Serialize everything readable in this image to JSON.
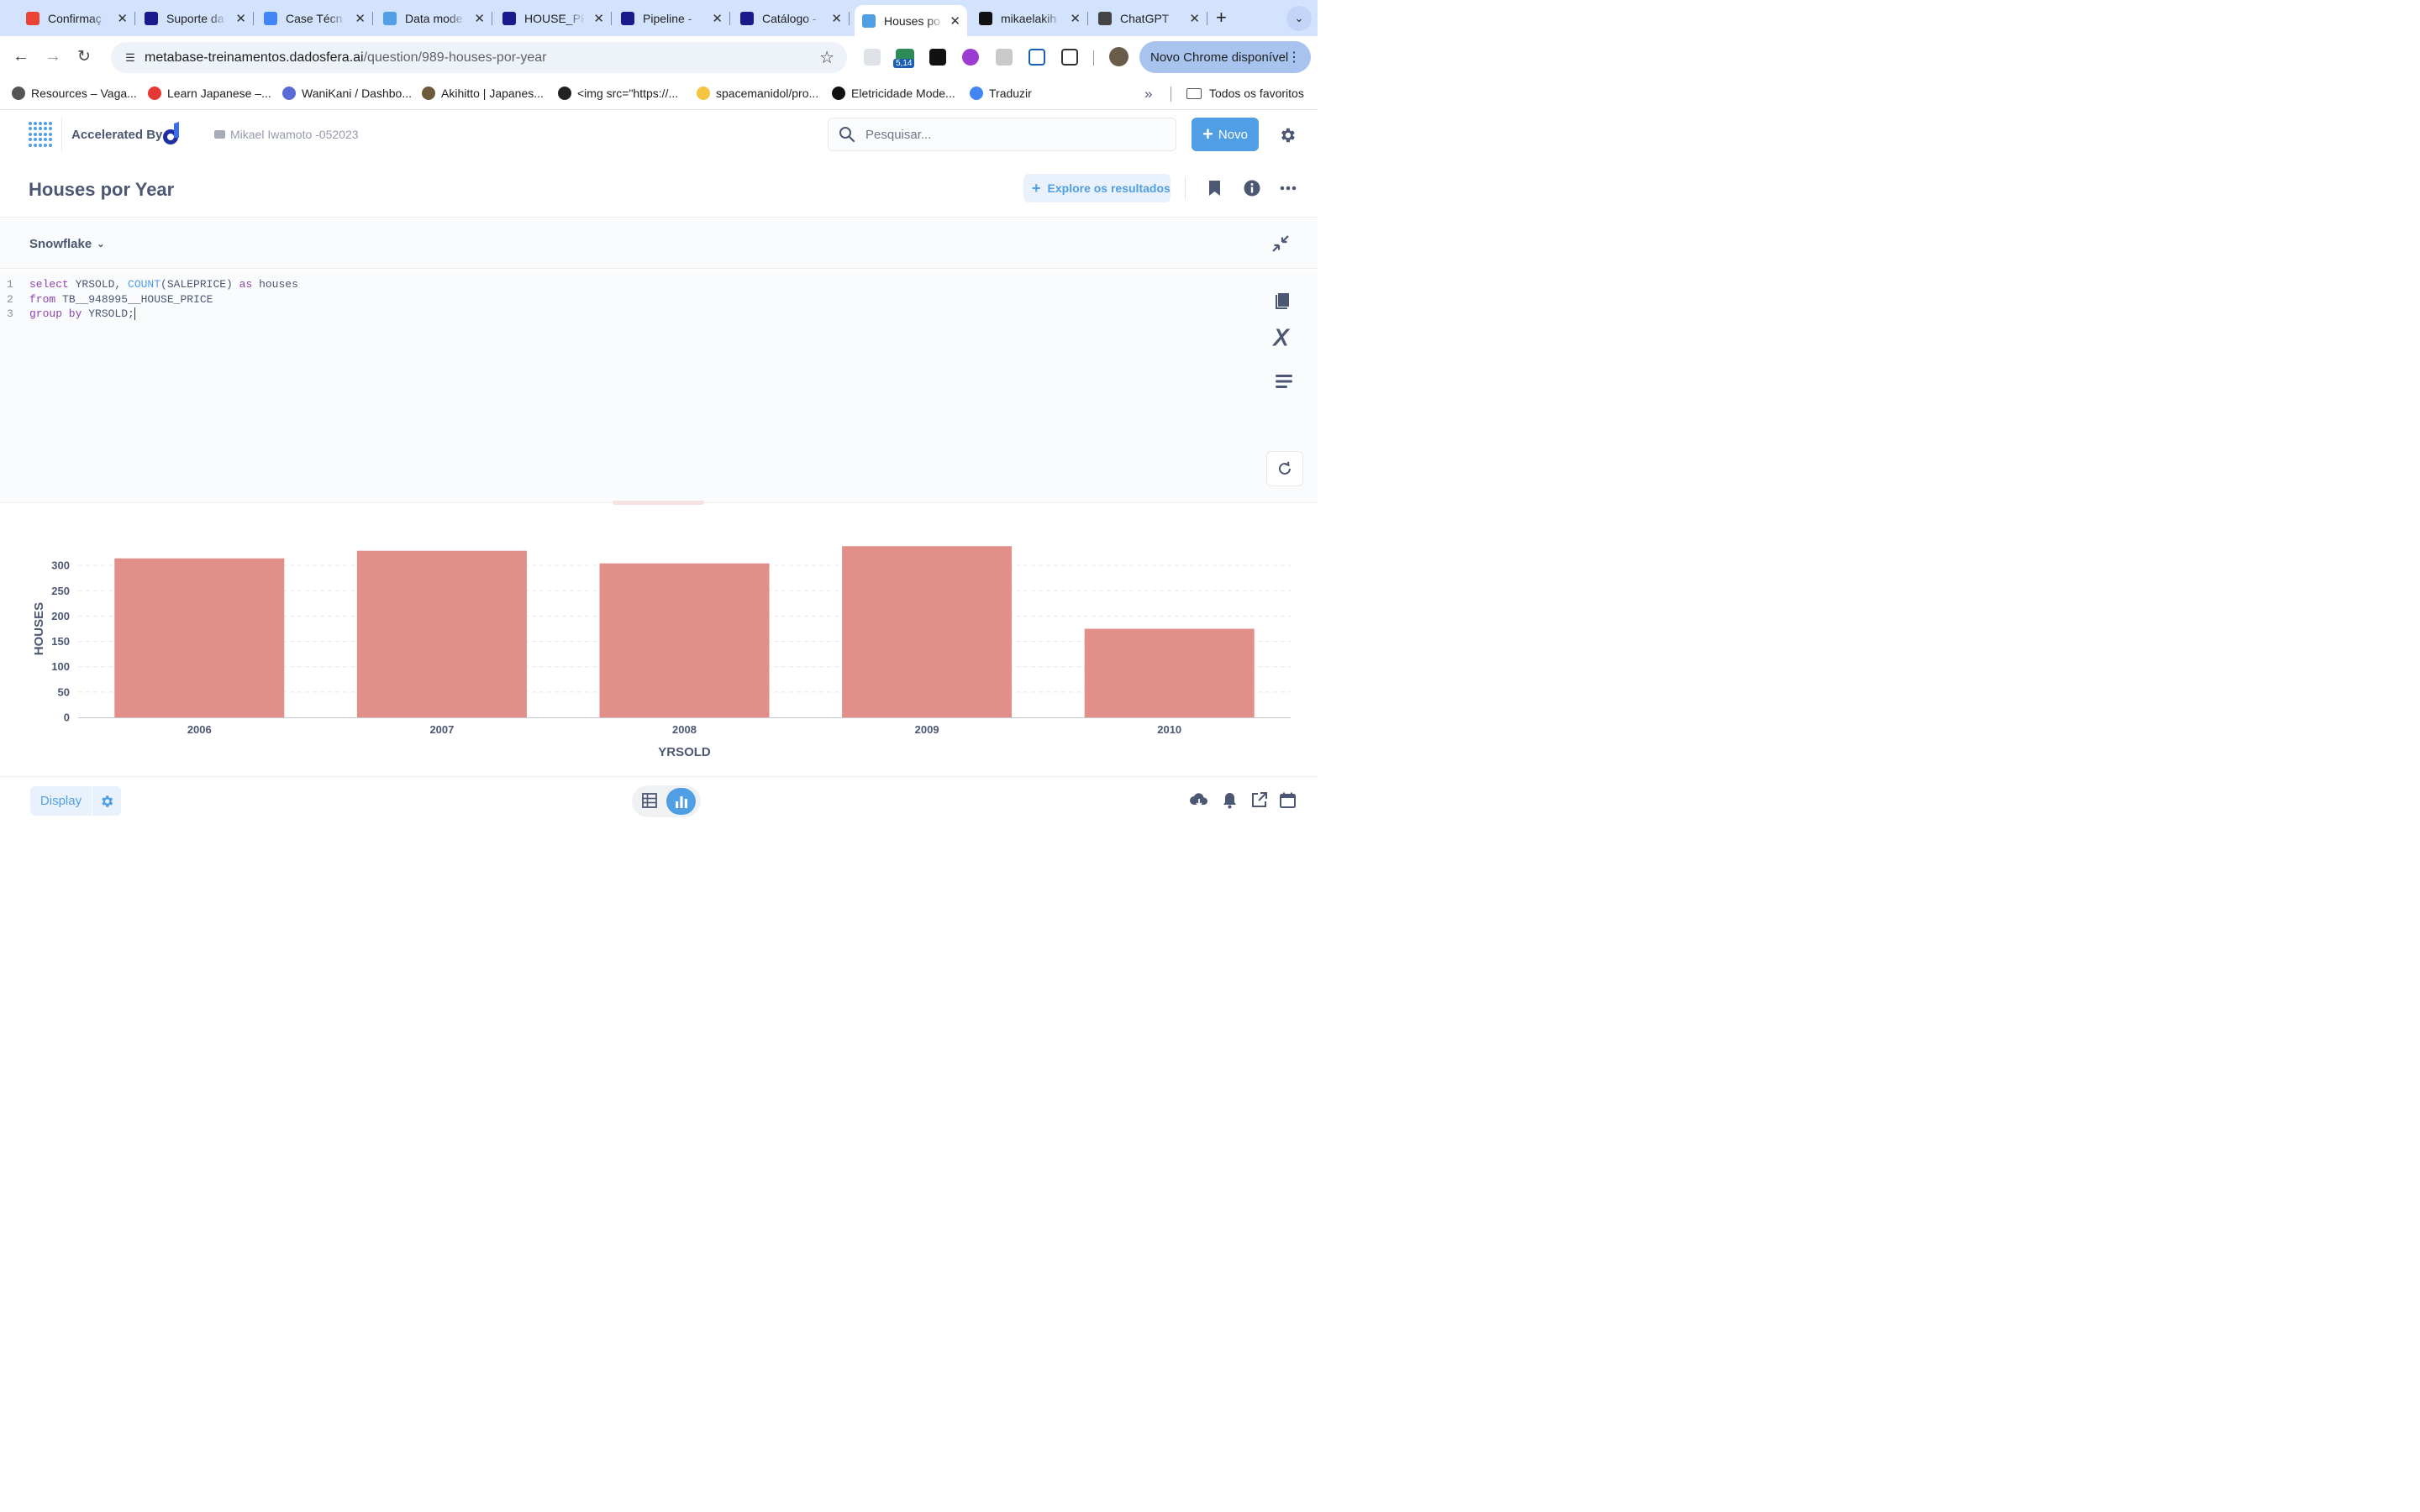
{
  "browser": {
    "tabs": [
      {
        "title": "Confirmaç",
        "favicon": "gmail-icon",
        "color": "#ea4335"
      },
      {
        "title": "Suporte da",
        "favicon": "dadosfera-icon",
        "color": "#1a1a8c"
      },
      {
        "title": "Case Técn",
        "favicon": "google-docs-icon",
        "color": "#4285f4"
      },
      {
        "title": "Data mode",
        "favicon": "metabase-icon",
        "color": "#509ee3"
      },
      {
        "title": "HOUSE_PR",
        "favicon": "dadosfera-icon",
        "color": "#1a1a8c"
      },
      {
        "title": "Pipeline -",
        "favicon": "dadosfera-icon",
        "color": "#1a1a8c"
      },
      {
        "title": "Catálogo -",
        "favicon": "dadosfera-icon",
        "color": "#1a1a8c"
      },
      {
        "title": "Houses po",
        "favicon": "metabase-icon",
        "color": "#509ee3"
      },
      {
        "title": "mikaelakih",
        "favicon": "github-icon",
        "color": "#111111"
      },
      {
        "title": "ChatGPT",
        "favicon": "openai-icon",
        "color": "#444444"
      }
    ],
    "active_tab_index": 7,
    "url_host": "metabase-treinamentos.dadosfera.ai",
    "url_path": "/question/989-houses-por-year",
    "extension_badge": "5,14",
    "update_button": "Novo Chrome disponível",
    "bookmarks": [
      {
        "label": "Resources – Vaga...",
        "icon": "vgb-icon",
        "color": "#555555"
      },
      {
        "label": "Learn Japanese –...",
        "icon": "tk-icon",
        "color": "#e53935"
      },
      {
        "label": "WaniKani / Dashbo...",
        "icon": "wanikani-icon",
        "color": "#5a6bd6"
      },
      {
        "label": "Akihitto | Japanes...",
        "icon": "akihitto-icon",
        "color": "#6d5a3a"
      },
      {
        "label": "<img src=\"https://...",
        "icon": "code-icon",
        "color": "#222222"
      },
      {
        "label": "spacemanidol/pro...",
        "icon": "emoji-icon",
        "color": "#f5c542"
      },
      {
        "label": "Eletricidade Mode...",
        "icon": "circle-icon",
        "color": "#111111"
      },
      {
        "label": "Traduzir",
        "icon": "translate-icon",
        "color": "#4285f4"
      }
    ],
    "all_bookmarks": "Todos os favoritos"
  },
  "app": {
    "brand": "Accelerated By",
    "breadcrumb": "Mikael Iwamoto -052023",
    "search_placeholder": "Pesquisar...",
    "new_button": "Novo",
    "accent": "#509ee3"
  },
  "question": {
    "title": "Houses por Year",
    "explore_button": "Explore os resultados",
    "database": "Snowflake",
    "sql_lines": [
      {
        "n": "1",
        "parts": [
          {
            "t": "select",
            "c": "kw"
          },
          {
            "t": " YRSOLD, ",
            "c": ""
          },
          {
            "t": "COUNT",
            "c": "fn"
          },
          {
            "t": "(SALEPRICE) ",
            "c": ""
          },
          {
            "t": "as",
            "c": "kw"
          },
          {
            "t": " houses",
            "c": ""
          }
        ]
      },
      {
        "n": "2",
        "parts": [
          {
            "t": "from",
            "c": "kw"
          },
          {
            "t": " TB__948995__HOUSE_PRICE",
            "c": ""
          }
        ]
      },
      {
        "n": "3",
        "parts": [
          {
            "t": "group by",
            "c": "kw"
          },
          {
            "t": " YRSOLD;",
            "c": ""
          }
        ]
      }
    ]
  },
  "chart_data": {
    "type": "bar",
    "categories": [
      "2006",
      "2007",
      "2008",
      "2009",
      "2010"
    ],
    "values": [
      314,
      329,
      304,
      338,
      175
    ],
    "xlabel": "YRSOLD",
    "ylabel": "HOUSES",
    "yticks": [
      0,
      50,
      100,
      150,
      200,
      250,
      300
    ],
    "ylim": [
      0,
      350
    ],
    "grid": true,
    "bar_color": "#e28f8a"
  },
  "footer": {
    "display_button": "Display"
  }
}
